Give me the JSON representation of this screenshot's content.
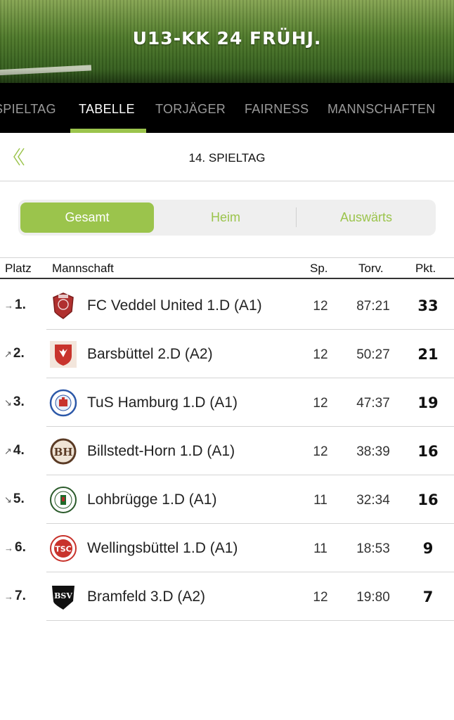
{
  "header": {
    "title": "U13-KK 24 FRÜHJ."
  },
  "tabs": [
    {
      "label": "SPIELTAG",
      "active": false
    },
    {
      "label": "TABELLE",
      "active": true
    },
    {
      "label": "TORJÄGER",
      "active": false
    },
    {
      "label": "FAIRNESS",
      "active": false
    },
    {
      "label": "MANNSCHAFTEN",
      "active": false
    }
  ],
  "matchday": {
    "back_icon": "double-chevron-left-icon",
    "title": "14. SPIELTAG"
  },
  "segmented": {
    "options": [
      "Gesamt",
      "Heim",
      "Auswärts"
    ],
    "selected": "Gesamt"
  },
  "table": {
    "headers": {
      "rank": "Platz",
      "team": "Mannschaft",
      "played": "Sp.",
      "goals": "Torv.",
      "points": "Pkt."
    },
    "rows": [
      {
        "trend": "→",
        "rank": "1.",
        "team": "FC Veddel United 1.D (A1)",
        "played": "12",
        "goals": "87:21",
        "points": "33",
        "logo": "fc-veddel-crest"
      },
      {
        "trend": "↗",
        "rank": "2.",
        "team": "Barsbüttel 2.D (A2)",
        "played": "12",
        "goals": "50:27",
        "points": "21",
        "logo": "barsbuettel-crest"
      },
      {
        "trend": "↘",
        "rank": "3.",
        "team": "TuS Hamburg 1.D (A1)",
        "played": "12",
        "goals": "47:37",
        "points": "19",
        "logo": "tus-hamburg-crest"
      },
      {
        "trend": "↗",
        "rank": "4.",
        "team": "Billstedt-Horn 1.D (A1)",
        "played": "12",
        "goals": "38:39",
        "points": "16",
        "logo": "billstedt-horn-crest"
      },
      {
        "trend": "↘",
        "rank": "5.",
        "team": "Lohbrügge 1.D (A1)",
        "played": "11",
        "goals": "32:34",
        "points": "16",
        "logo": "lohbruegge-crest"
      },
      {
        "trend": "→",
        "rank": "6.",
        "team": "Wellingsbüttel 1.D (A1)",
        "played": "11",
        "goals": "18:53",
        "points": "9",
        "logo": "tsc-wellingsbuettel-crest"
      },
      {
        "trend": "→",
        "rank": "7.",
        "team": "Bramfeld 3.D (A2)",
        "played": "12",
        "goals": "19:80",
        "points": "7",
        "logo": "bramfeld-crest"
      }
    ]
  },
  "colors": {
    "accent": "#9bc44c",
    "tabbar": "#000000",
    "header_grass": "#4f7a2a"
  },
  "crest_text": {
    "tsc": "TSC",
    "bsv": "BSV",
    "bh": "BH"
  }
}
